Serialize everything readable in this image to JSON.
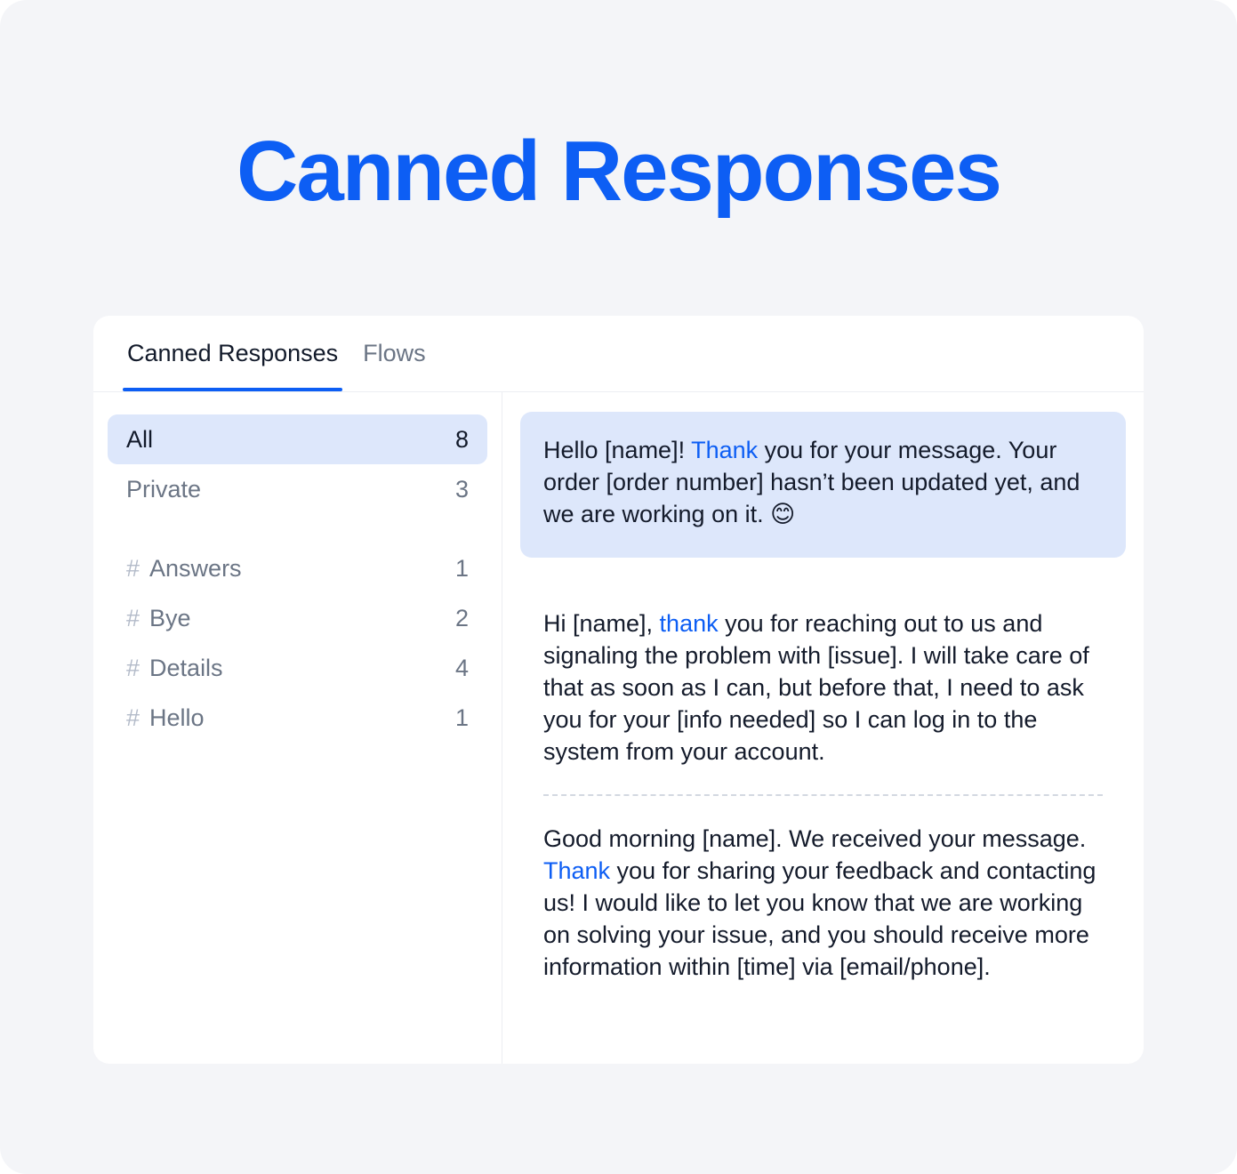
{
  "page": {
    "title": "Canned Responses",
    "background_color": "#f4f5f8",
    "accent_color": "#0d5ef4"
  },
  "tabs": [
    {
      "label": "Canned Responses",
      "active": true
    },
    {
      "label": "Flows",
      "active": false
    }
  ],
  "sidebar": {
    "items": [
      {
        "label": "All",
        "count": "8",
        "hash": "",
        "selected": true
      },
      {
        "label": "Private",
        "count": "3",
        "hash": "",
        "selected": false
      },
      {
        "label": "Answers",
        "count": "1",
        "hash": "#",
        "selected": false
      },
      {
        "label": "Bye",
        "count": "2",
        "hash": "#",
        "selected": false
      },
      {
        "label": "Details",
        "count": "4",
        "hash": "#",
        "selected": false
      },
      {
        "label": "Hello",
        "count": "1",
        "hash": "#",
        "selected": false
      }
    ]
  },
  "messages": [
    {
      "highlight": true,
      "pre": "Hello [name]! ",
      "keyword": "Thank",
      "post": " you for your message. Your order [order number] hasn’t been updated yet, and we are working on it. ",
      "emoji": "😊"
    },
    {
      "highlight": false,
      "pre": "Hi [name], ",
      "keyword": "thank",
      "post": " you for reaching out to us and signaling the problem with [issue]. I will take care of that as soon as I can, but before that, I need to ask you for your [info needed] so I can log in to the system from your account.",
      "emoji": ""
    },
    {
      "highlight": false,
      "pre": "Good morning [name]. We received your message. ",
      "keyword": "Thank",
      "post": " you for sharing your feedback and contacting us! I would like to let you know that we are working on solving your issue, and you should receive more information within [time] via [email/phone].",
      "emoji": ""
    }
  ]
}
